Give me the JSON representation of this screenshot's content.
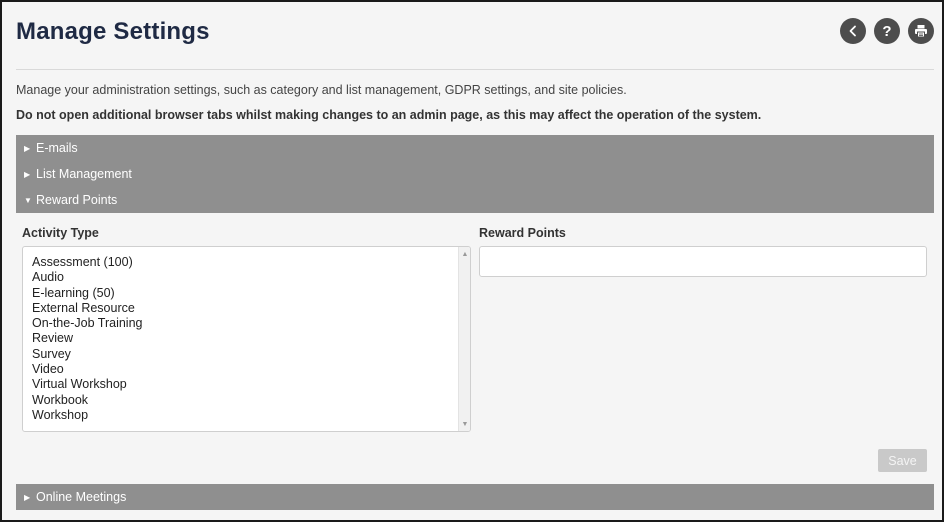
{
  "page": {
    "title": "Manage Settings",
    "intro": "Manage your administration settings, such as category and list management, GDPR settings, and site policies.",
    "warning": "Do not open additional browser tabs whilst making changes to an admin page, as this may affect the operation of the system."
  },
  "header_buttons": {
    "back_icon": "chevron-left-icon",
    "help_label": "?",
    "print_icon": "printer-icon"
  },
  "accordion": {
    "emails": {
      "label": "E-mails",
      "arrow": "▶",
      "expanded": false
    },
    "list_management": {
      "label": "List Management",
      "arrow": "▶",
      "expanded": false
    },
    "reward_points": {
      "label": "Reward Points",
      "arrow": "▼",
      "expanded": true
    },
    "online_meetings": {
      "label": "Online Meetings",
      "arrow": "▶",
      "expanded": false
    }
  },
  "reward_panel": {
    "activity_type_label": "Activity Type",
    "reward_points_label": "Reward Points",
    "activity_types": [
      "Assessment (100)",
      "Audio",
      "E-learning (50)",
      "External Resource",
      "On-the-Job Training",
      "Review",
      "Survey",
      "Video",
      "Virtual Workshop",
      "Workbook",
      "Workshop"
    ],
    "reward_points_value": "",
    "save_label": "Save"
  },
  "colors": {
    "accordion_bar": "#8f8f8f",
    "header_button": "#4d4d4d",
    "title": "#1f2a44",
    "save_disabled": "#c9c9c9"
  }
}
